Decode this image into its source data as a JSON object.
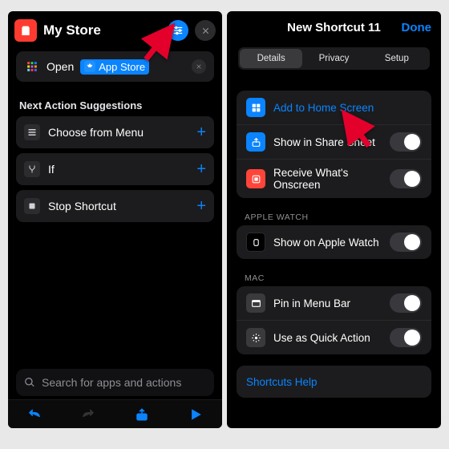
{
  "left": {
    "title": "My Store",
    "open_label": "Open",
    "app_chip": "App Store",
    "suggest_header": "Next Action Suggestions",
    "suggestions": [
      {
        "label": "Choose from Menu"
      },
      {
        "label": "If"
      },
      {
        "label": "Stop Shortcut"
      }
    ],
    "search_placeholder": "Search for apps and actions"
  },
  "right": {
    "title": "New Shortcut 11",
    "done": "Done",
    "tabs": [
      "Details",
      "Privacy",
      "Setup"
    ],
    "rows_main": [
      {
        "label": "Add to Home Screen",
        "link": true,
        "toggle": false,
        "icon": "home"
      },
      {
        "label": "Show in Share Sheet",
        "toggle": true,
        "icon": "share"
      },
      {
        "label": "Receive What's Onscreen",
        "toggle": true,
        "icon": "screen"
      }
    ],
    "group_watch": "APPLE WATCH",
    "rows_watch": [
      {
        "label": "Show on Apple Watch",
        "toggle": true,
        "icon": "watch"
      }
    ],
    "group_mac": "MAC",
    "rows_mac": [
      {
        "label": "Pin in Menu Bar",
        "toggle": true,
        "icon": "menubar"
      },
      {
        "label": "Use as Quick Action",
        "toggle": true,
        "icon": "gear"
      }
    ],
    "help": "Shortcuts Help"
  }
}
